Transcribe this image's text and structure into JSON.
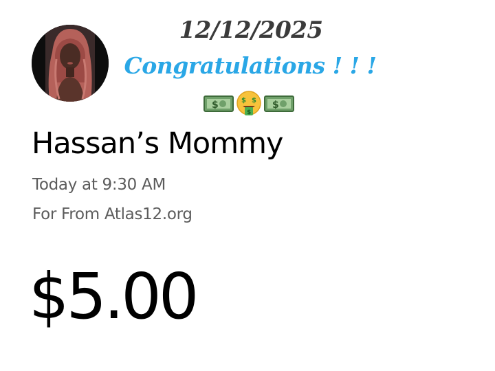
{
  "avatar": {
    "icon": "profile-photo",
    "ring_color": "#0d0d0d",
    "hair_color": "#b5615a"
  },
  "banner": {
    "date": "12/12/2025",
    "message": "Congratulations ! ! !",
    "message_color": "#2aa7e6",
    "emojis": [
      "money-bill-icon",
      "money-mouth-face-icon",
      "money-bill-icon"
    ]
  },
  "transaction": {
    "sender": "Hassan’s Mommy",
    "time": "Today at 9:30 AM",
    "note": "For From Atlas12.org",
    "amount": "$5.00"
  }
}
